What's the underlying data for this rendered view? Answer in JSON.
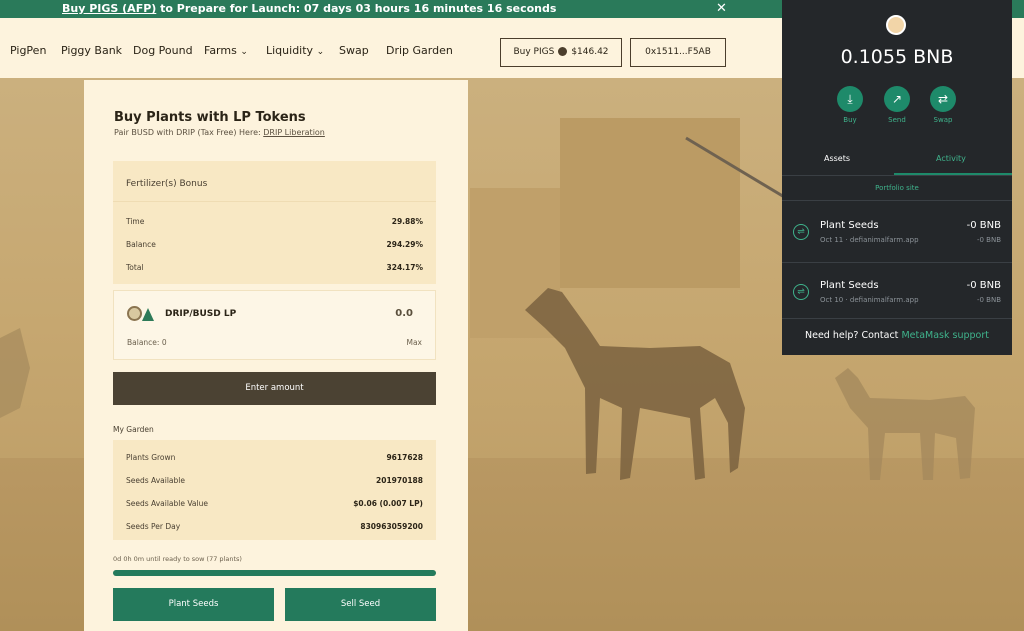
{
  "banner": {
    "link_text": "Buy PIGS (AFP)",
    "rest_text": " to Prepare for Launch: 07 days 03 hours 16 minutes 16 seconds",
    "close_symbol": "✕"
  },
  "nav": {
    "items": [
      "PigPen",
      "Piggy Bank",
      "Dog Pound",
      "Farms",
      "Liquidity",
      "Swap",
      "Drip Garden"
    ],
    "chevron": "⌄",
    "buy_pigs_label": "Buy PIGS",
    "buy_pigs_price": "$146.42",
    "wallet_address": "0x1511...F5AB"
  },
  "card": {
    "title": "Buy Plants with LP Tokens",
    "subtitle_prefix": "Pair BUSD with DRIP (Tax Free) Here: ",
    "subtitle_link": "DRIP Liberation",
    "fertilizer": {
      "title": "Fertilizer(s) Bonus",
      "rows": [
        {
          "label": "Time",
          "value": "29.88%"
        },
        {
          "label": "Balance",
          "value": "294.29%"
        },
        {
          "label": "Total",
          "value": "324.17%"
        }
      ]
    },
    "lp": {
      "name": "DRIP/BUSD LP",
      "amount": "0.0",
      "balance": "Balance: 0",
      "max": "Max"
    },
    "enter_button": "Enter amount",
    "garden_label": "My Garden",
    "garden_rows": [
      {
        "label": "Plants Grown",
        "value": "9617628"
      },
      {
        "label": "Seeds Available",
        "value": "201970188"
      },
      {
        "label": "Seeds Available Value",
        "value": "$0.06 (0.007 LP)"
      },
      {
        "label": "Seeds Per Day",
        "value": "830963059200"
      }
    ],
    "ready_text": "0d 0h 0m until ready to sow (77 plants)",
    "progress": 1.0,
    "plant_button": "Plant Seeds",
    "sell_button": "Sell Seed"
  },
  "metamask": {
    "balance": "0.1055 BNB",
    "actions": [
      {
        "label": "Buy",
        "icon": "download-icon",
        "glyph": "⤓"
      },
      {
        "label": "Send",
        "icon": "send-arrow-icon",
        "glyph": "↗"
      },
      {
        "label": "Swap",
        "icon": "swap-icon",
        "glyph": "⇄"
      }
    ],
    "tabs": [
      "Assets",
      "Activity"
    ],
    "active_tab": "Activity",
    "portfolio_link": "Portfolio site",
    "transactions": [
      {
        "name": "Plant Seeds",
        "sub": "Oct 11 · defianimalfarm.app",
        "amount": "-0 BNB",
        "amount_sub": "-0 BNB"
      },
      {
        "name": "Plant Seeds",
        "sub": "Oct 10 · defianimalfarm.app",
        "amount": "-0 BNB",
        "amount_sub": "-0 BNB"
      }
    ],
    "help_prefix": "Need help? Contact ",
    "help_link": "MetaMask support"
  },
  "colors": {
    "accent_green": "#247a5c",
    "banner_green": "#2a7a5a",
    "cream": "#fdf3dd",
    "metamask_bg": "#24272a"
  }
}
